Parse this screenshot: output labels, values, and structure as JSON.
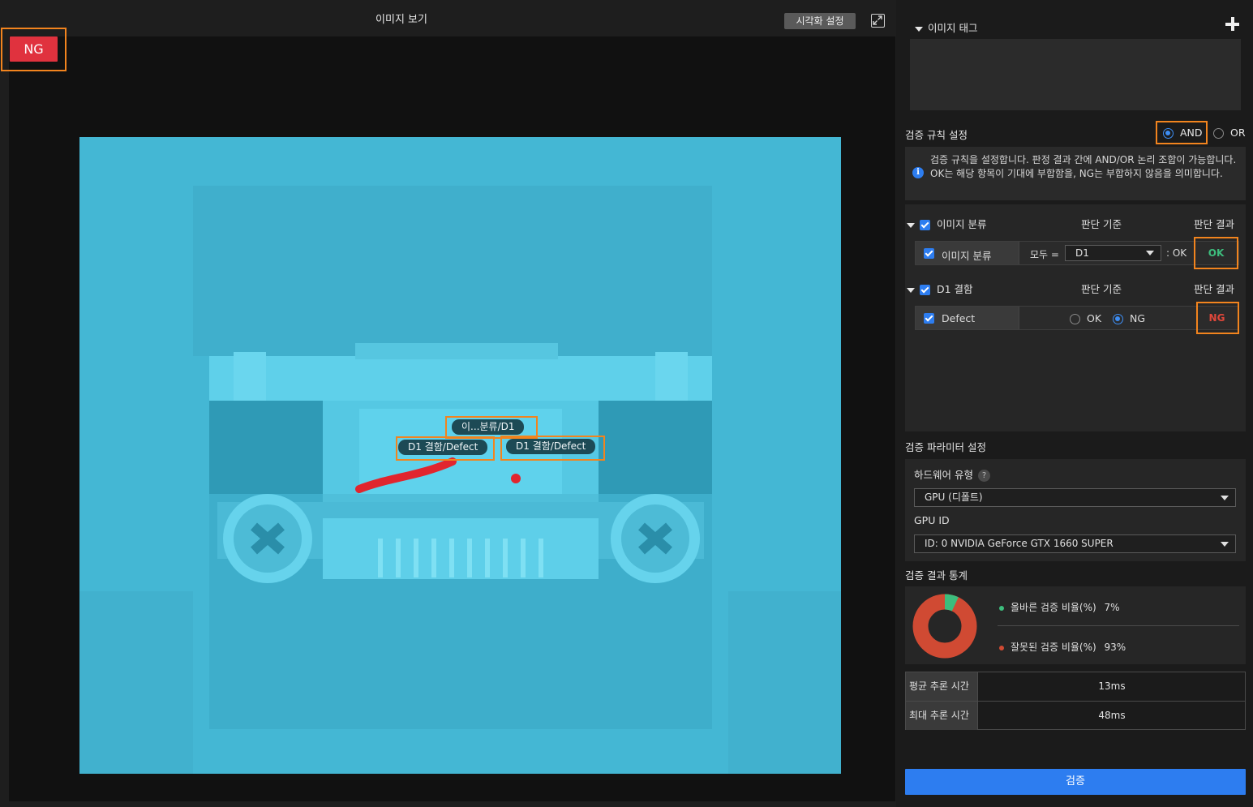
{
  "viewer": {
    "title": "이미지 보기",
    "viz_button": "시각화 설정",
    "result_badge": "NG",
    "labels": {
      "classification": "이...분류/D1",
      "defect_1": "D1 결함/Defect",
      "defect_2": "D1 결함/Defect"
    }
  },
  "tags": {
    "title": "이미지 태그"
  },
  "rules": {
    "title": "검증 규칙 설정",
    "logic_and": "AND",
    "logic_or": "OR",
    "logic_selected": "AND",
    "info": "검증 규칙을 설정합니다. 판정 결과 간에 AND/OR 논리 조합이 가능합니다. OK는 해당 항목이 기대에 부합함을, NG는 부합하지 않음을 의미합니다.",
    "groups": [
      {
        "name": "이미지 분류",
        "criteria_header": "판단 기준",
        "result_header": "판단 결과",
        "row": {
          "name": "이미지 분류",
          "prefix": "모두 =",
          "select_value": "D1",
          "suffix": ": OK",
          "result": "OK"
        }
      },
      {
        "name": "D1 결함",
        "criteria_header": "판단 기준",
        "result_header": "판단 결과",
        "row": {
          "name": "Defect",
          "opt_ok": "OK",
          "opt_ng": "NG",
          "selected": "NG",
          "result": "NG"
        }
      }
    ]
  },
  "params": {
    "title": "검증 파라미터 설정",
    "hardware_label": "하드웨어 유형",
    "hardware_value": "GPU (디폴트)",
    "gpu_id_label": "GPU ID",
    "gpu_id_value": "ID: 0  NVIDIA GeForce GTX 1660 SUPER"
  },
  "stats": {
    "title": "검증 결과 통계",
    "correct_label": "올바른 검증 비율(%)",
    "correct_value": "7%",
    "correct_pct": 7,
    "wrong_label": "잘못된 검증 비율(%)",
    "wrong_value": "93%",
    "wrong_pct": 93,
    "colors": {
      "correct": "#3dbd7d",
      "wrong": "#d04a33"
    }
  },
  "timing": {
    "avg_label": "평균 추론 시간",
    "avg_value": "13ms",
    "max_label": "최대 추론 시간",
    "max_value": "48ms"
  },
  "verify_button": "검증"
}
